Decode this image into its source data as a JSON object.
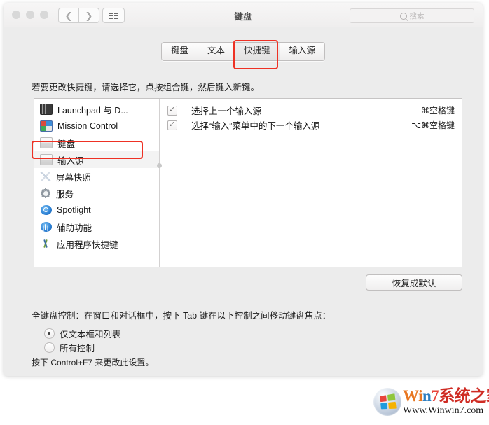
{
  "window": {
    "title": "键盘",
    "traffic_lights": [
      "close",
      "minimize",
      "zoom"
    ],
    "nav": {
      "back_icon": "chevron-left-icon",
      "forward_icon": "chevron-right-icon",
      "grid_icon": "show-all-icon"
    },
    "search": {
      "placeholder": "搜索",
      "value": "",
      "icon": "search-icon"
    }
  },
  "tabs": [
    {
      "label": "键盘",
      "active": false
    },
    {
      "label": "文本",
      "active": false
    },
    {
      "label": "快捷键",
      "active": true
    },
    {
      "label": "输入源",
      "active": false
    }
  ],
  "hint": "若要更改快捷键，请选择它，点按组合键，然后键入新键。",
  "sidebar": {
    "items": [
      {
        "label": "Launchpad 与 D...",
        "icon": "launchpad-icon",
        "selected": false
      },
      {
        "label": "Mission Control",
        "icon": "mission-control-icon",
        "selected": false
      },
      {
        "label": "键盘",
        "icon": "keyboard-icon",
        "selected": false
      },
      {
        "label": "输入源",
        "icon": "input-source-icon",
        "selected": true
      },
      {
        "label": "屏幕快照",
        "icon": "screenshot-icon",
        "selected": false
      },
      {
        "label": "服务",
        "icon": "services-gear-icon",
        "selected": false
      },
      {
        "label": "Spotlight",
        "icon": "spotlight-icon",
        "selected": false
      },
      {
        "label": "辅助功能",
        "icon": "accessibility-icon",
        "selected": false
      },
      {
        "label": "应用程序快捷键",
        "icon": "app-shortcuts-icon",
        "selected": false
      }
    ]
  },
  "shortcuts": [
    {
      "checked": true,
      "name": "选择上一个输入源",
      "key": "⌘空格键"
    },
    {
      "checked": true,
      "name": "选择“输入”菜单中的下一个输入源",
      "key": "⌥⌘空格键"
    }
  ],
  "restore_button": "恢复成默认",
  "full_keyboard_access": {
    "label": "全键盘控制：在窗口和对话框中，按下 Tab 键在以下控制之间移动键盘焦点：",
    "options": [
      {
        "label": "仅文本框和列表",
        "selected": true
      },
      {
        "label": "所有控制",
        "selected": false
      }
    ],
    "footnote": "按下 Control+F7 来更改此设置。"
  },
  "annotations": {
    "color": "#ee3124",
    "boxes": [
      "快捷键",
      "输入源"
    ]
  },
  "watermark": {
    "brand_w": "W",
    "brand_i": "i",
    "brand_n": "n",
    "brand_7": "7",
    "brand_cn": "系统之家",
    "url": "Www.Winwin7.com"
  }
}
